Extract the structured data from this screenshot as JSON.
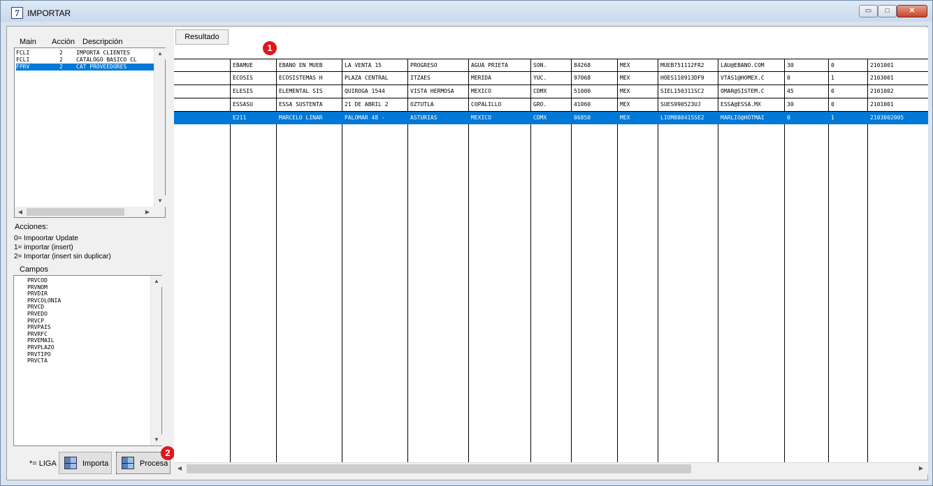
{
  "window": {
    "title": "IMPORTAR",
    "icon": "app-7-icon",
    "min": "▭",
    "max": "□",
    "close": "✕"
  },
  "left": {
    "col_main": "Main",
    "col_accion": "Acción",
    "col_descripcion": "Descripción",
    "list": [
      {
        "main": "FCLI",
        "accion": "2",
        "descripcion": "IMPORTA CLIENTES",
        "selected": false
      },
      {
        "main": "FCLI",
        "accion": "2",
        "descripcion": "CATALOGO BASICO CL",
        "selected": false
      },
      {
        "main": "FPRV",
        "accion": "2",
        "descripcion": "CAT PROVEEDORES",
        "selected": true
      }
    ],
    "acciones_label": "Acciones:",
    "acciones": [
      "0= Impoortar Update",
      "1= importar (insert)",
      "2= Importar (insert sin duplicar)"
    ],
    "campos_label": "Campos",
    "campos": [
      "PRVCOD",
      "PRVNOM",
      "PRVDIR",
      "PRVCOLONIA",
      "PRVCD",
      "PRVEDO",
      "PRVCP",
      "PRVPAIS",
      "PRVRFC",
      "PRVEMAIL",
      "PRVPLAZO",
      "PRVTIPO",
      "PRVCTA"
    ],
    "liga": "*= LIGA",
    "importa": "Importa",
    "procesa": "Procesa"
  },
  "grid": {
    "resultado_button": "Resultado",
    "rows": [
      {
        "selected": false,
        "cells": [
          "EBAMUE",
          "EBANO EN MUEB",
          "LA VENTA 15",
          "PROGRESO",
          "AGUA PRIETA",
          "SON.",
          "84268",
          "MEX",
          "MUEB751112FR2",
          "LAU@EBANO.COM",
          "30",
          "0",
          "2101001"
        ]
      },
      {
        "selected": false,
        "cells": [
          "ECOSIS",
          "ECOSISTEMAS H",
          "PLAZA CENTRAL",
          "ITZAES",
          "MERIDA",
          "YUC.",
          "97068",
          "MEX",
          "HOES110913DF9",
          "VTAS1@HOMEX.C",
          "0",
          "1",
          "2103001"
        ]
      },
      {
        "selected": false,
        "cells": [
          "ELESIS",
          "ELEMENTAL SIS",
          "QUIROGA 1544",
          "VISTA HERMOSA",
          "MEXICO",
          "CDMX",
          "51000",
          "MEX",
          "SIEL150311SC2",
          "OMAR@SISTEM.C",
          "45",
          "0",
          "2101002"
        ]
      },
      {
        "selected": false,
        "cells": [
          "ESSASU",
          "ESSA SUSTENTA",
          "21 DE ABRIL 2",
          "OZTUTLA",
          "COPALILLO",
          "GRO.",
          "41060",
          "MEX",
          "SUES990523UJ",
          "ESSA@ESSA.MX",
          "30",
          "0",
          "2101001"
        ]
      },
      {
        "selected": true,
        "cells": [
          "E211",
          "MARCELO LINAR",
          "PALOMAR 48 -",
          "ASTURIAS",
          "MEXICO",
          "CDMX",
          "06850",
          "MEX",
          "LIOM880415SE2",
          "MARLIO@HOTMAI",
          "0",
          "1",
          "2103002005"
        ]
      }
    ]
  },
  "badges": {
    "one": "1",
    "two": "2"
  },
  "colors": {
    "selection": "#0078d7",
    "badge": "#e0161b"
  }
}
